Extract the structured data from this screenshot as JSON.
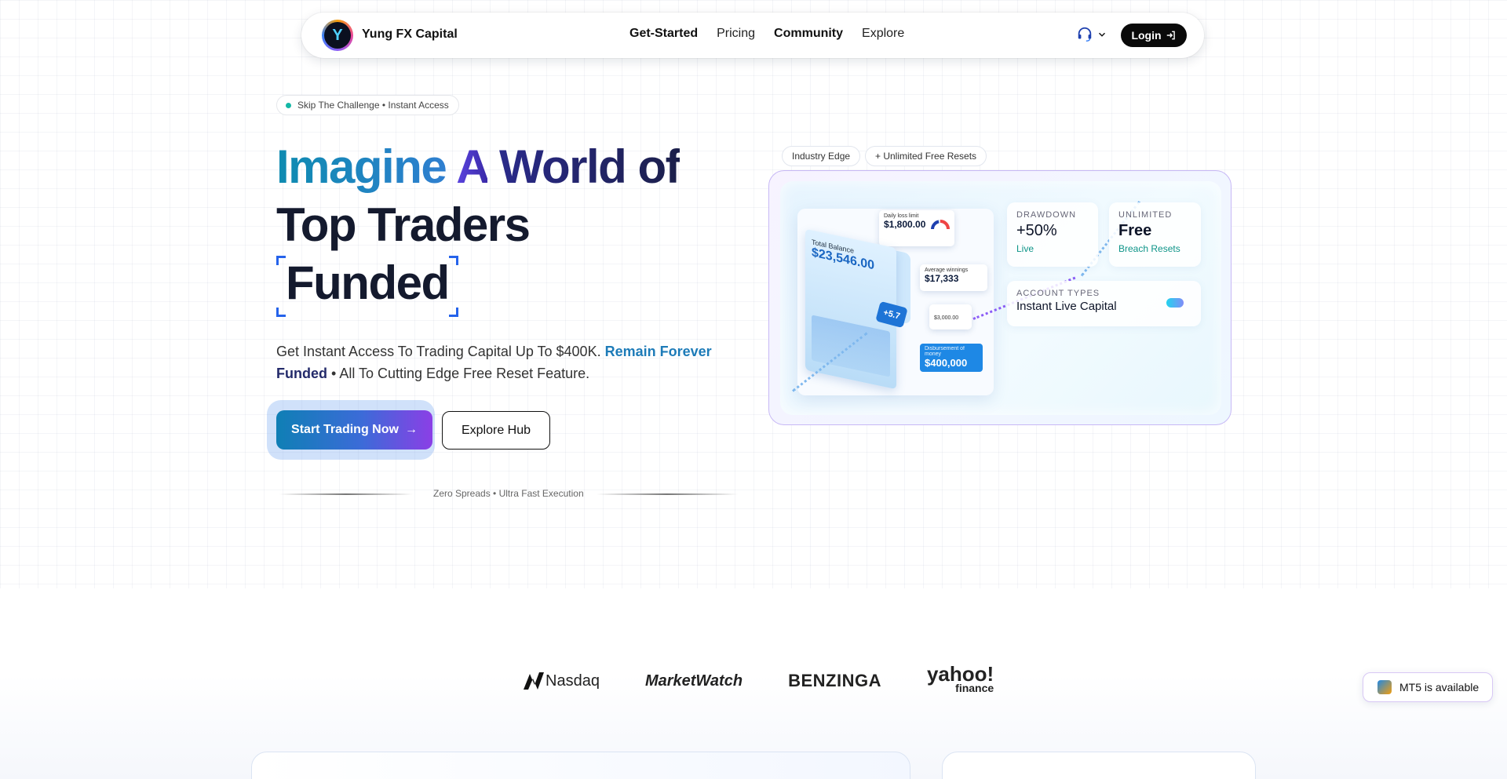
{
  "nav": {
    "brand": "Yung FX Capital",
    "logo_letter": "Y",
    "links": [
      "Get-Started",
      "Pricing",
      "Community",
      "Explore"
    ],
    "login_label": "Login"
  },
  "hero": {
    "badge": "Skip The Challenge • Instant Access",
    "headline_w1": "Imagine",
    "headline_w2": "A",
    "headline_w3": "World of",
    "headline_line2": "Top Traders",
    "headline_line3": "Funded",
    "sub_1": "Get Instant Access To Trading Capital Up To $400K.",
    "sub_hl1": "Remain Forever",
    "sub_hl2": "Funded",
    "sub_2": "• All To Cutting Edge Free Reset Feature.",
    "cta_primary": "Start Trading Now",
    "cta_secondary": "Explore Hub",
    "divider_text": "Zero Spreads • Ultra Fast Execution"
  },
  "showcase": {
    "tags": [
      "Industry Edge",
      "+ Unlimited Free Resets"
    ],
    "mock": {
      "daily_loss_label": "Daily loss limit",
      "daily_loss_value": "$1,800.00",
      "avg_win_label": "Average winnings",
      "avg_win_value": "$17,333",
      "balance_label": "Total Balance",
      "balance_value": "$23,546.00",
      "badge": "+5.7",
      "small_value": "$3,000.00",
      "payout_label": "Disbursement of money",
      "payout_value": "$400,000"
    },
    "stats": {
      "drawdown_cap": "DRAWDOWN",
      "drawdown_value": "+50%",
      "drawdown_foot": "Live",
      "unlimited_cap": "UNLIMITED",
      "unlimited_value": "Free",
      "unlimited_foot": "Breach Resets",
      "account_cap": "ACCOUNT TYPES",
      "account_value": "Instant Live Capital"
    }
  },
  "press_logos": [
    "Nasdaq",
    "MarketWatch",
    "BENZINGA",
    "yahoo!",
    "finance"
  ],
  "mt5_label": "MT5 is available"
}
